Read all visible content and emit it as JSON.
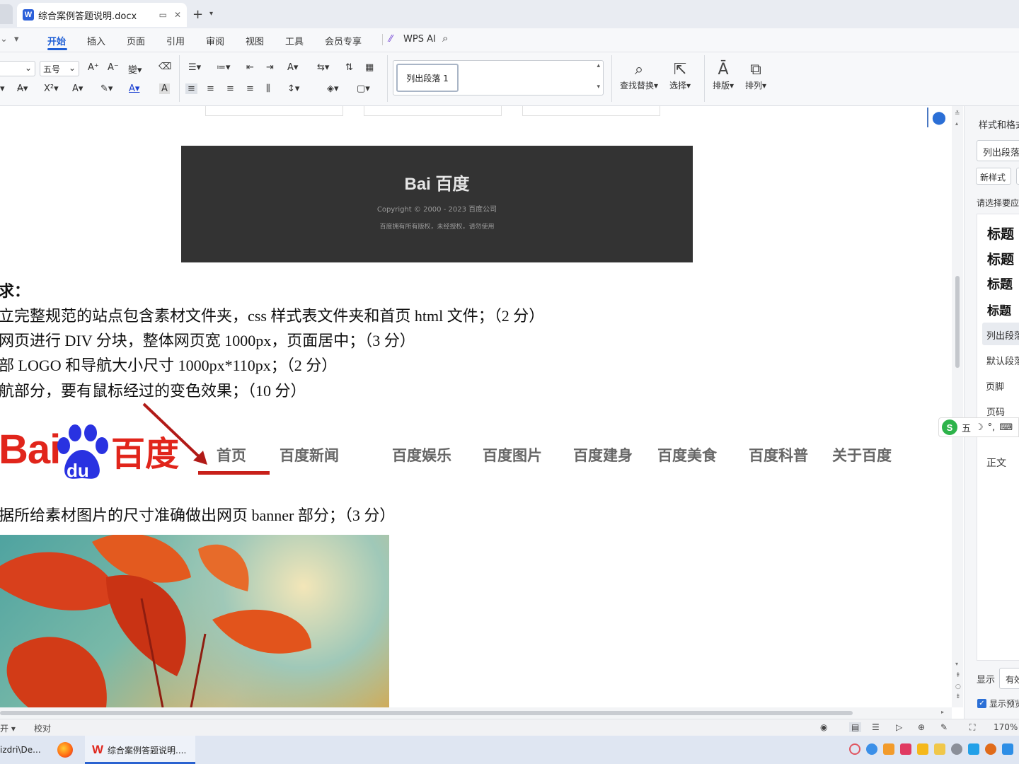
{
  "tabbar": {
    "doc_title": "综合案例答题说明.docx",
    "app_letter": "W"
  },
  "menu": {
    "items": [
      "开始",
      "插入",
      "页面",
      "引用",
      "审阅",
      "视图",
      "工具",
      "会员专享"
    ],
    "ai_label": "WPS AI"
  },
  "toolbar": {
    "font_size": "五号",
    "style_current": "列出段落 1",
    "find_replace": "查找替换",
    "select": "选择",
    "layout": "排版",
    "arrange": "排列"
  },
  "document": {
    "footer_image": {
      "logo_text": "Bai  百度",
      "copyright": "Copyright © 2000 - 2023 百度公司",
      "rights": "百度拥有所有版权，未经授权，请勿使用"
    },
    "requirements_title": "求：",
    "lines": [
      "建立完整规范的站点包含素材文件夹，css 样式表文件夹和首页 html 文件；（2 分）",
      "对网页进行 DIV 分块，整体网页宽 1000px，页面居中；（3 分）",
      "头部 LOGO 和导航大小尺寸 1000px*110px；（2 分）",
      "导航部分，要有鼠标经过的变色效果；（10 分）"
    ],
    "nav_image": {
      "logo": "Bai",
      "logo_du": "du",
      "logo_cn": "百度",
      "items": [
        "首页",
        "百度新闻",
        "百度娱乐",
        "百度图片",
        "百度建身",
        "百度美食",
        "百度科普",
        "关于百度"
      ],
      "accent_color": "#c8201a"
    },
    "banner_line": "根据所给素材图片的尺寸准确做出网页 banner 部分；（3 分）"
  },
  "right_panel": {
    "title": "样式和格式",
    "current_style": "列出段落",
    "new_style": "新样式",
    "prompt": "请选择要应用的格式",
    "headings": [
      "标题",
      "标题",
      "标题",
      "标题"
    ],
    "styles": [
      "列出段落",
      "默认段落",
      "页脚",
      "页码",
      "正文"
    ],
    "display_label": "显示",
    "display_value": "有效",
    "preview_check": "显示预览"
  },
  "ime": {
    "logo": "S",
    "mode": "五"
  },
  "statusbar": {
    "left": "开",
    "proofread": "校对",
    "zoom": "170%"
  },
  "taskbar": {
    "explorer": "izdri\\De...",
    "wps_window": "综合案例答题说明...."
  }
}
